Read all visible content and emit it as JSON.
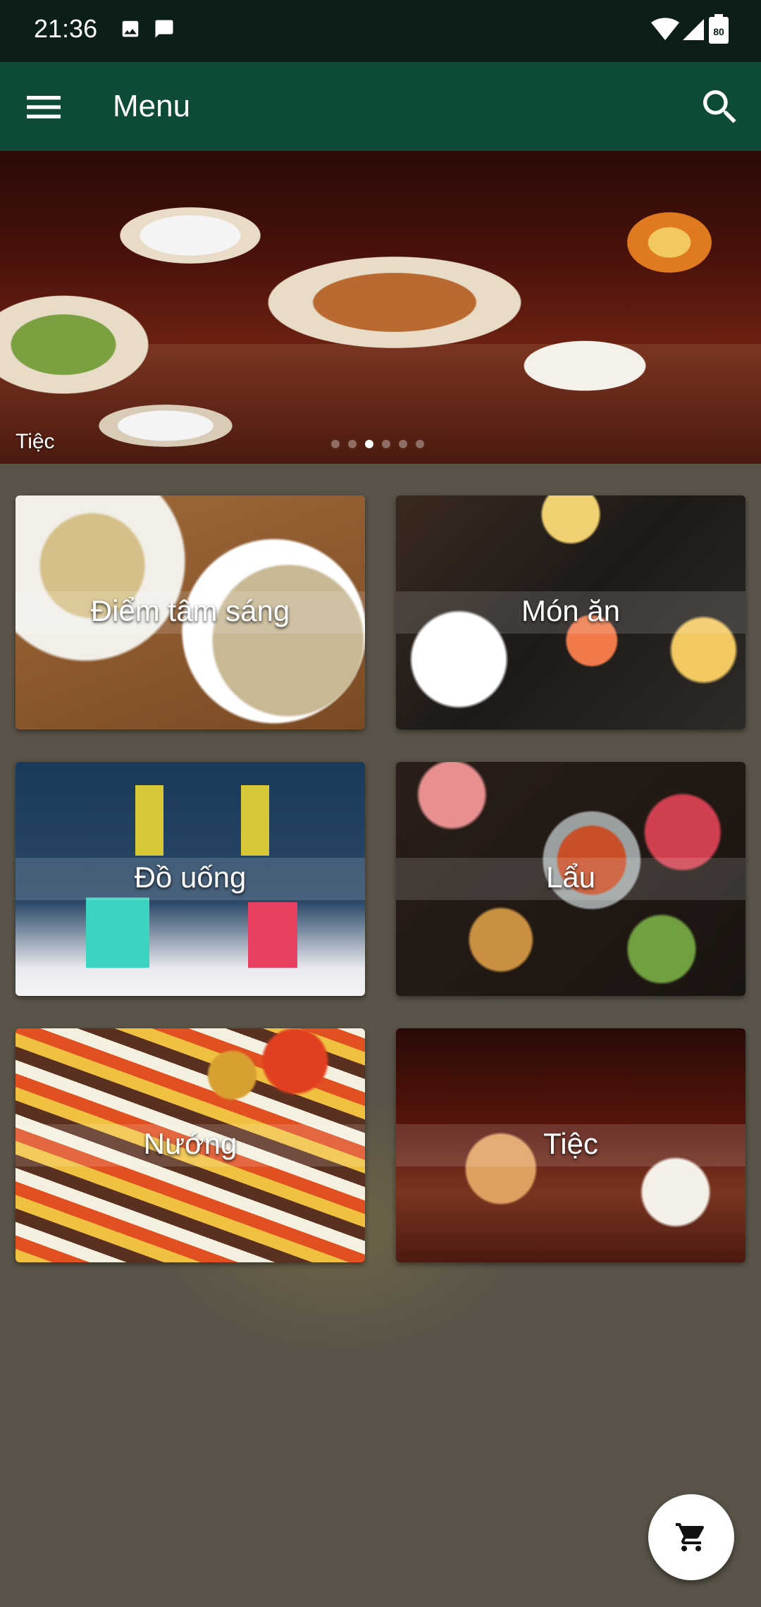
{
  "status_bar": {
    "time": "21:36",
    "battery": "80",
    "icons": [
      "image-notification-icon",
      "message-notification-icon",
      "wifi-icon",
      "cellular-signal-icon",
      "battery-icon"
    ]
  },
  "app_bar": {
    "title": "Menu",
    "menu_icon": "hamburger-menu-icon",
    "search_icon": "search-icon"
  },
  "banner": {
    "caption": "Tiệc",
    "page_count": 6,
    "active_index": 2
  },
  "categories": [
    {
      "label": "Điểm tâm sáng"
    },
    {
      "label": "Món ăn"
    },
    {
      "label": "Đồ uống"
    },
    {
      "label": "Lẩu"
    },
    {
      "label": "Nướng"
    },
    {
      "label": "Tiệc"
    }
  ],
  "fab": {
    "icon": "shopping-cart-icon"
  },
  "colors": {
    "status_bar": "#0c1f16",
    "app_bar": "#0d4a38",
    "background": "#5a5448"
  }
}
